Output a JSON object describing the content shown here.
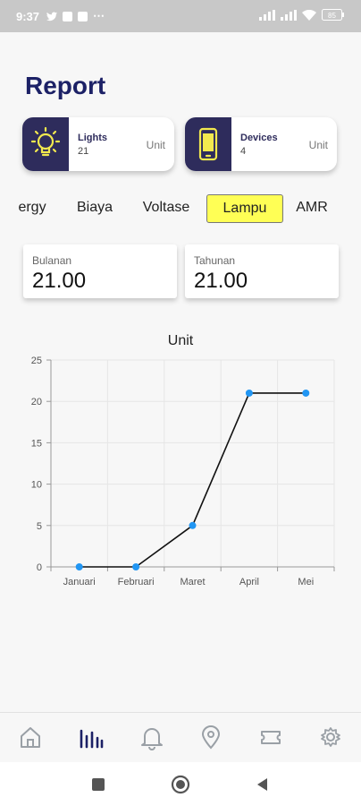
{
  "status_bar": {
    "time": "9:37",
    "battery": "85"
  },
  "page": {
    "title": "Report"
  },
  "cards": [
    {
      "title": "Lights",
      "value": "21",
      "unit": "Unit",
      "icon": "lightbulb-icon"
    },
    {
      "title": "Devices",
      "value": "4",
      "unit": "Unit",
      "icon": "phone-icon"
    }
  ],
  "tabs": [
    "ergy",
    "Biaya",
    "Voltase",
    "Lampu",
    "AMR"
  ],
  "active_tab": "Lampu",
  "stats": [
    {
      "label": "Bulanan",
      "value": "21.00"
    },
    {
      "label": "Tahunan",
      "value": "21.00"
    }
  ],
  "chart_data": {
    "type": "line",
    "title": "Unit",
    "categories": [
      "Januari",
      "Februari",
      "Maret",
      "April",
      "Mei"
    ],
    "values": [
      0,
      0,
      5,
      21,
      21
    ],
    "ylim": [
      0,
      25
    ],
    "yticks": [
      0,
      5,
      10,
      15,
      20,
      25
    ],
    "grid": true,
    "line_color": "#111111",
    "point_color": "#2196f3"
  },
  "bottom_nav": [
    "home-icon",
    "bar-chart-icon",
    "bell-icon",
    "location-pin-icon",
    "ticket-icon",
    "gear-icon"
  ],
  "colors": {
    "navy": "#1c2166",
    "card_icon_bg": "#2e2c5c",
    "active_tab": "#ffff55"
  }
}
